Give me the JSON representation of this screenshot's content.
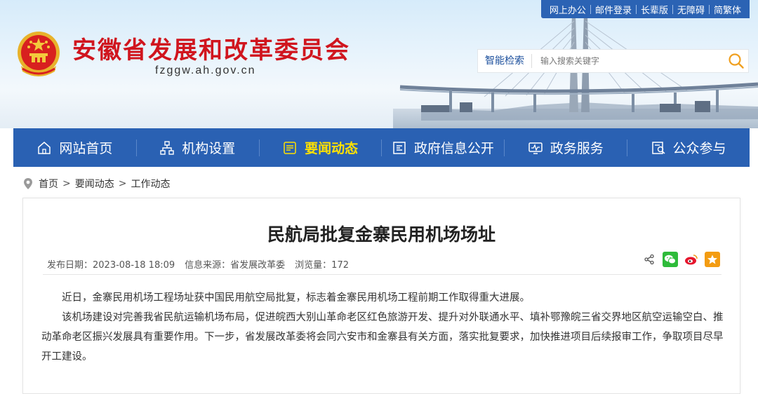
{
  "top_links": [
    "网上办公",
    "邮件登录",
    "长辈版",
    "无障碍",
    "简繁体"
  ],
  "site": {
    "title": "安徽省发展和改革委员会",
    "domain": "fzggw.ah.gov.cn"
  },
  "search": {
    "label": "智能检索",
    "placeholder": "输入搜索关键字"
  },
  "nav": [
    {
      "label": "网站首页",
      "icon": "home-icon",
      "active": false
    },
    {
      "label": "机构设置",
      "icon": "org-chart-icon",
      "active": false
    },
    {
      "label": "要闻动态",
      "icon": "news-icon",
      "active": true
    },
    {
      "label": "政府信息公开",
      "icon": "info-disclosure-icon",
      "active": false
    },
    {
      "label": "政务服务",
      "icon": "service-monitor-icon",
      "active": false
    },
    {
      "label": "公众参与",
      "icon": "participation-icon",
      "active": false
    }
  ],
  "breadcrumb": {
    "items": [
      "首页",
      "要闻动态",
      "工作动态"
    ],
    "separator": ">"
  },
  "article": {
    "title": "民航局批复金寨民用机场场址",
    "meta": {
      "date": "发布日期：2023-08-18 18:09",
      "source": "信息来源：省发展改革委",
      "views": "浏览量：172"
    },
    "paragraphs": [
      "近日，金寨民用机场工程场址获中国民用航空局批复，标志着金寨民用机场工程前期工作取得重大进展。",
      "该机场建设对完善我省民航运输机场布局，促进皖西大别山革命老区红色旅游开发、提升对外联通水平、填补鄂豫皖三省交界地区航空运输空白、推动革命老区振兴发展具有重要作用。下一步，省发展改革委将会同六安市和金寨县有关方面，落实批复要求，加快推进项目后续报审工作，争取项目尽早开工建设。"
    ]
  },
  "share_icons": [
    "share-icon",
    "wechat-icon",
    "weibo-icon",
    "favorite-icon"
  ],
  "colors": {
    "nav_bg": "#2a61b3",
    "active_nav": "#ffe100",
    "title_red": "#d0151e",
    "toplinks_bg": "#2b63b4",
    "search_icon": "#f0a020"
  }
}
